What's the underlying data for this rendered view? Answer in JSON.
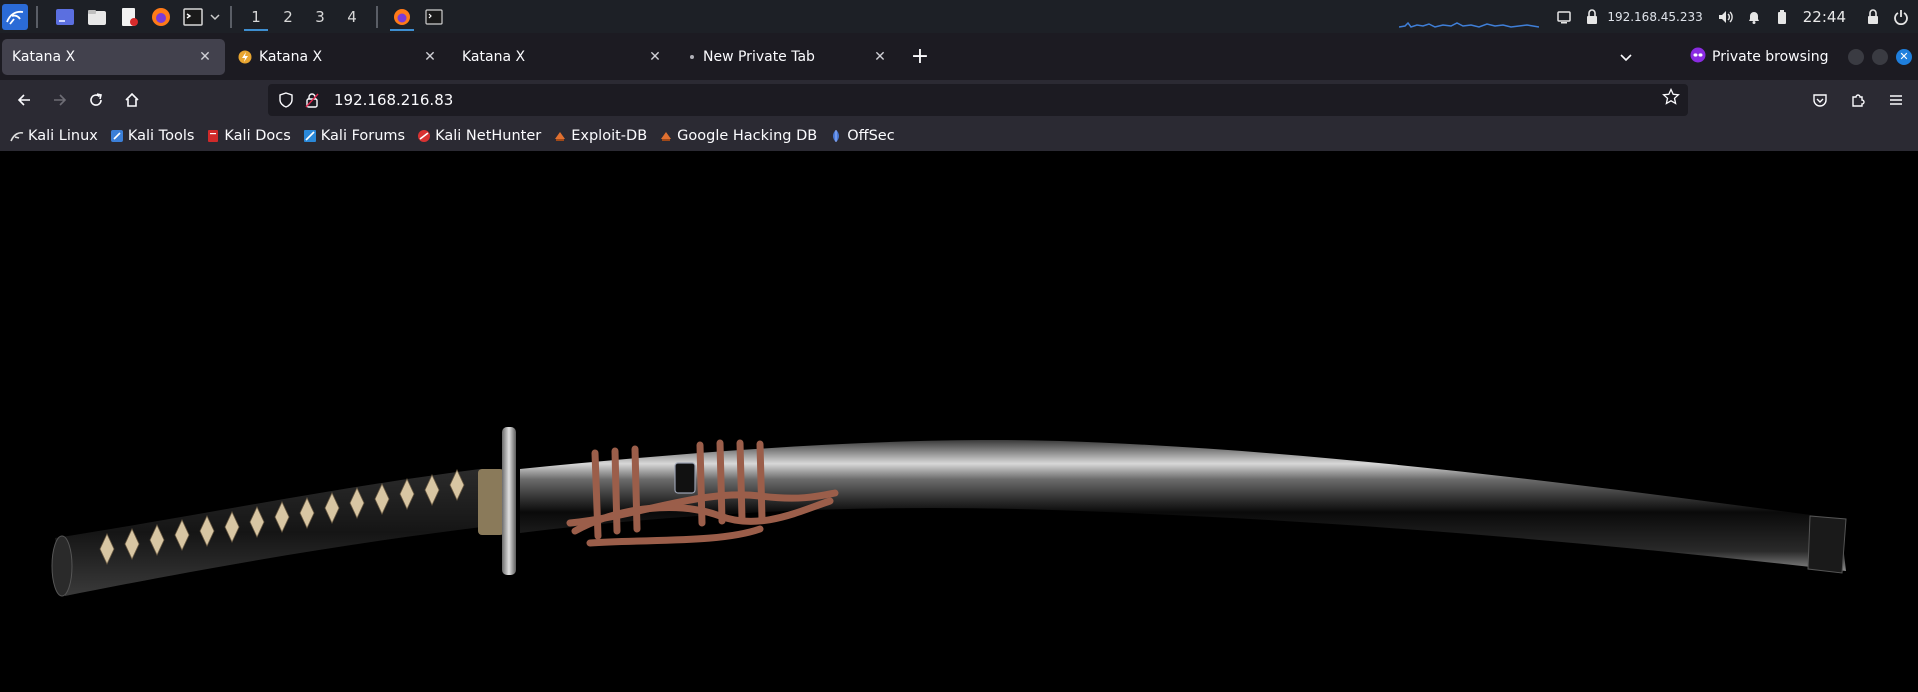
{
  "panel": {
    "workspaces": [
      "1",
      "2",
      "3",
      "4"
    ],
    "active_workspace": "1",
    "ip_address": "192.168.45.233",
    "clock": "22:44",
    "icons": [
      "kali-menu-icon",
      "desktop-icon",
      "file-manager-icon",
      "text-editor-icon",
      "firefox-icon",
      "terminal-icon",
      "chevron-down-icon"
    ]
  },
  "tabs": [
    {
      "title": "Katana X",
      "selected": true
    },
    {
      "title": "Katana X",
      "selected": false
    },
    {
      "title": "Katana X",
      "selected": false
    },
    {
      "title": "New Private Tab",
      "selected": false
    }
  ],
  "private_label": "Private browsing",
  "url": "192.168.216.83",
  "bookmarks": [
    {
      "label": "Kali Linux",
      "color": "#e0e0e0"
    },
    {
      "label": "Kali Tools",
      "color": "#3b7fd8"
    },
    {
      "label": "Kali Docs",
      "color": "#d02a2a"
    },
    {
      "label": "Kali Forums",
      "color": "#2a88d8"
    },
    {
      "label": "Kali NetHunter",
      "color": "#d83232"
    },
    {
      "label": "Exploit-DB",
      "color": "#e07030"
    },
    {
      "label": "Google Hacking DB",
      "color": "#e07030"
    },
    {
      "label": "OffSec",
      "color": "#4a7ad8"
    }
  ],
  "colors": {
    "panel_bg": "#1d2026",
    "tabstrip_bg": "#1c1b22",
    "toolbar_bg": "#2b2a33",
    "accent": "#3e8ed0"
  }
}
